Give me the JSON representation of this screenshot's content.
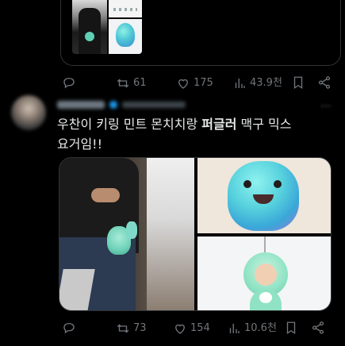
{
  "previous_tweet": {
    "actions": {
      "reply_count": "",
      "retweet_count": "61",
      "like_count": "175",
      "view_count": "43.9천"
    }
  },
  "tweet": {
    "text_line1_pre": "우찬이 키링 민트 몬치치랑 ",
    "text_line1_bold": "퍼글러",
    "text_line1_post": " 맥구 믹스",
    "text_line2": "요거임!!",
    "actions": {
      "reply_count": "",
      "retweet_count": "73",
      "like_count": "154",
      "view_count": "10.6천"
    }
  },
  "icons": {
    "reply": "reply-icon",
    "retweet": "retweet-icon",
    "like": "heart-icon",
    "views": "views-icon",
    "bookmark": "bookmark-icon",
    "share": "share-icon",
    "more": "more-icon"
  },
  "colors": {
    "background": "#000000",
    "text": "#e7e9ea",
    "muted": "#71767b",
    "border": "#2f3336",
    "verified": "#1d9bf0"
  }
}
